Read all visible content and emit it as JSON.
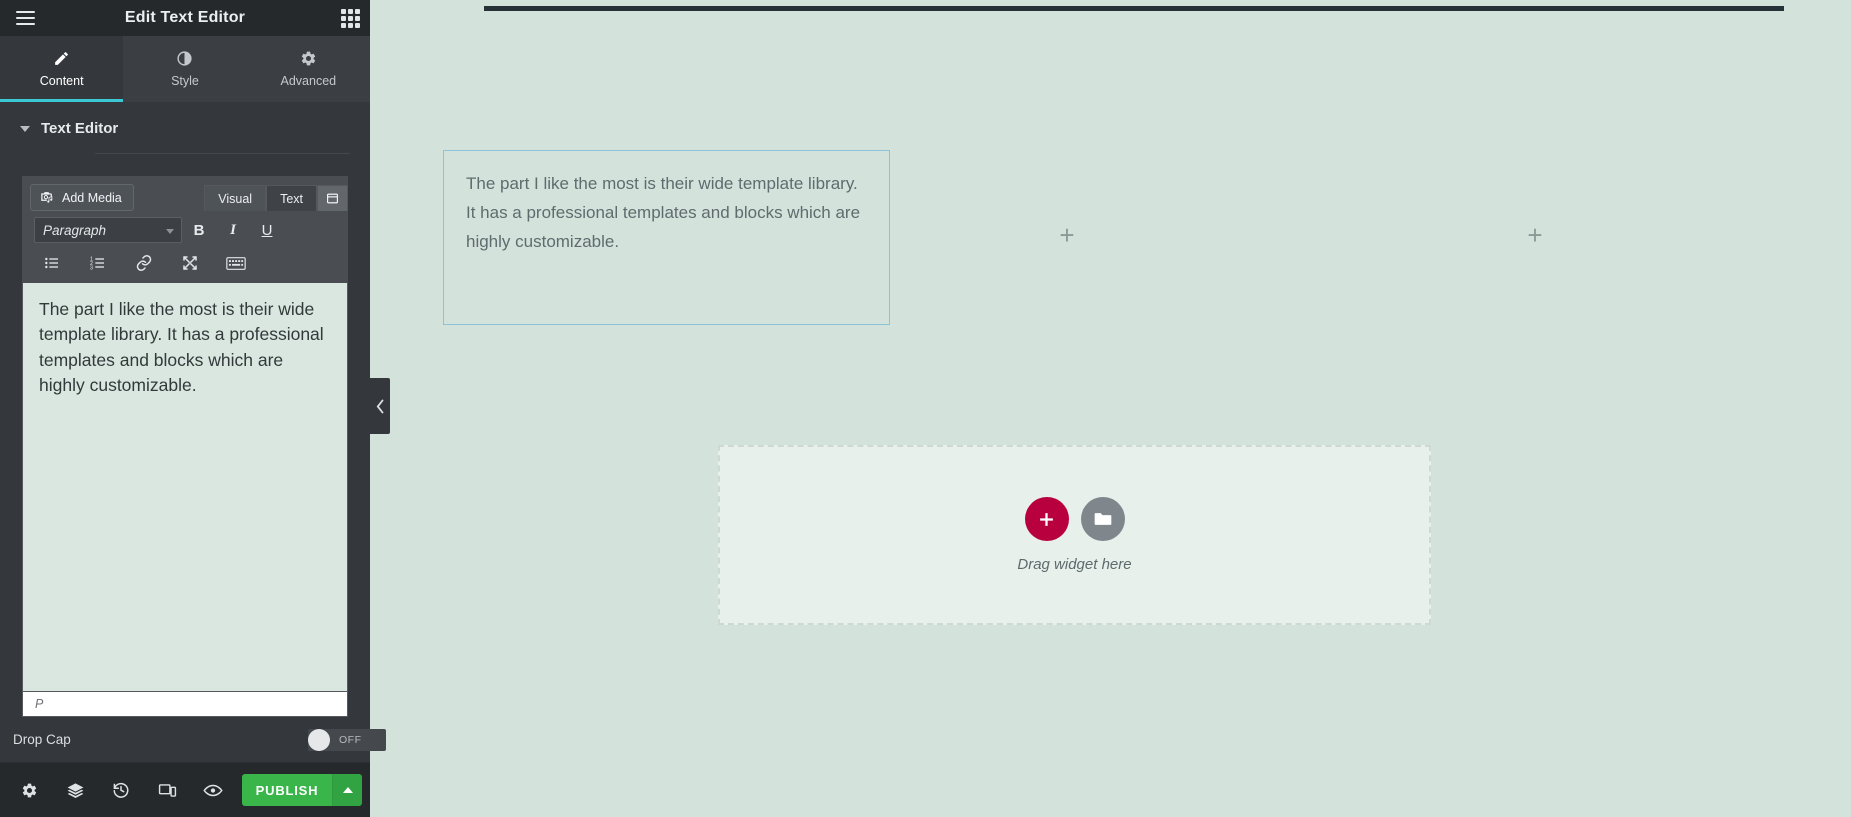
{
  "panel": {
    "title": "Edit Text Editor",
    "menu_icon": "hamburger-icon",
    "grid_icon": "grid-icon",
    "tabs": [
      {
        "label": "Content",
        "icon": "pencil-icon",
        "active": true
      },
      {
        "label": "Style",
        "icon": "contrast-half-circle-icon",
        "active": false
      },
      {
        "label": "Advanced",
        "icon": "gear-icon",
        "active": false
      }
    ],
    "section": {
      "title": "Text Editor",
      "caret": "chevron-down-icon"
    },
    "editor": {
      "add_media_label": "Add Media",
      "add_media_icon": "camera-music-icon",
      "mode_tabs": [
        {
          "label": "Visual",
          "active": true
        },
        {
          "label": "Text",
          "active": false
        }
      ],
      "kb_toggle_icon": "toolbar-toggle-icon",
      "format_select": "Paragraph",
      "bold_label": "B",
      "italic_label": "I",
      "underline_label": "U",
      "icons": [
        "unordered-list-icon",
        "ordered-list-icon",
        "link-icon",
        "fullscreen-icon",
        "keyboard-icon"
      ],
      "content": "The part I like the most is their wide template library. It has a professional templates and blocks which are highly customizable.",
      "status": "P"
    },
    "dropcap": {
      "label": "Drop Cap",
      "state": "OFF"
    },
    "bottom": {
      "icons": [
        "settings-gear-icon",
        "layers-icon",
        "history-revisions-icon",
        "responsive-mode-icon",
        "preview-eye-icon"
      ],
      "publish_label": "PUBLISH",
      "publish_caret_icon": "chevron-up-icon"
    },
    "collapse_handle_icon": "chevron-left-icon"
  },
  "canvas": {
    "text_widget": "The part I like the most is their wide template library. It has a professional templates and blocks which are highly customizable.",
    "add_section_markers": [
      "+",
      "+"
    ],
    "dropzone": {
      "add_icon": "plus-icon",
      "folder_icon": "folder-icon",
      "label": "Drag widget here"
    }
  },
  "colors": {
    "panel_bg": "#34383c",
    "header_bg": "#26292c",
    "accent_tab": "#3bc7d4",
    "publish_green": "#39b54a",
    "add_widget_red": "#b8003f",
    "canvas_bg": "#d4e2dc",
    "widget_border": "#8bc4d8"
  }
}
